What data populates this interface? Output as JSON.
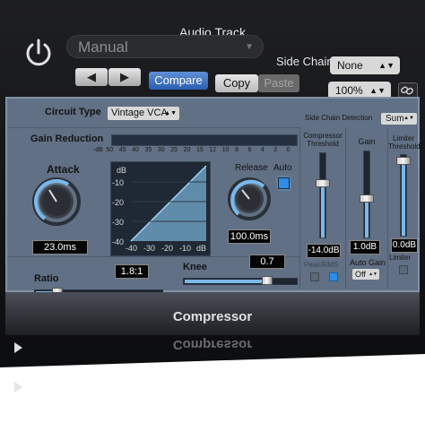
{
  "window": {
    "title": "Audio Track"
  },
  "header": {
    "preset": "Manual",
    "side_chain_label": "Side Chain:",
    "side_chain_value": "None",
    "compare_label": "Compare",
    "copy_label": "Copy",
    "paste_label": "Paste",
    "zoom": "100%"
  },
  "plugin": {
    "circuit_type_label": "Circuit Type",
    "circuit_type_value": "Vintage VCA",
    "side_chain_detection_label": "Side Chain Detection",
    "side_chain_detection_value": "Sum",
    "gain_reduction_label": "Gain Reduction",
    "meter_scale": [
      "-dB",
      "50",
      "45",
      "40",
      "35",
      "30",
      "25",
      "20",
      "15",
      "12",
      "10",
      "8",
      "6",
      "4",
      "2",
      "0"
    ],
    "attack_label": "Attack",
    "attack_value": "23.0ms",
    "release_label": "Release",
    "release_value": "100.0ms",
    "auto_label": "Auto",
    "auto_on": true,
    "graph_y_label": "dB",
    "graph_y_ticks": [
      "-10",
      "-20",
      "-30",
      "-40"
    ],
    "graph_x_ticks": [
      "-40",
      "-30",
      "-20",
      "-10",
      "dB"
    ],
    "ratio_label": "Ratio",
    "ratio_value": "1.8:1",
    "knee_label": "Knee",
    "knee_value": "0.7",
    "threshold_label_1": "Compressor",
    "threshold_label_2": "Threshold",
    "threshold_value": "-14.0dB",
    "gain_label": "Gain",
    "gain_value": "1.0dB",
    "limiter_threshold_label_1": "Limiter",
    "limiter_threshold_label_2": "Threshold",
    "limiter_threshold_value": "0.0dB",
    "peak_rms_label": "Peak/RMS",
    "auto_gain_label": "Auto Gain",
    "auto_gain_value": "Off",
    "limiter_label": "Limiter",
    "plugin_name": "Compressor"
  },
  "colors": {
    "accent": "#2a5eb2",
    "panel": "#617084",
    "meter": "#7ab8ea"
  }
}
